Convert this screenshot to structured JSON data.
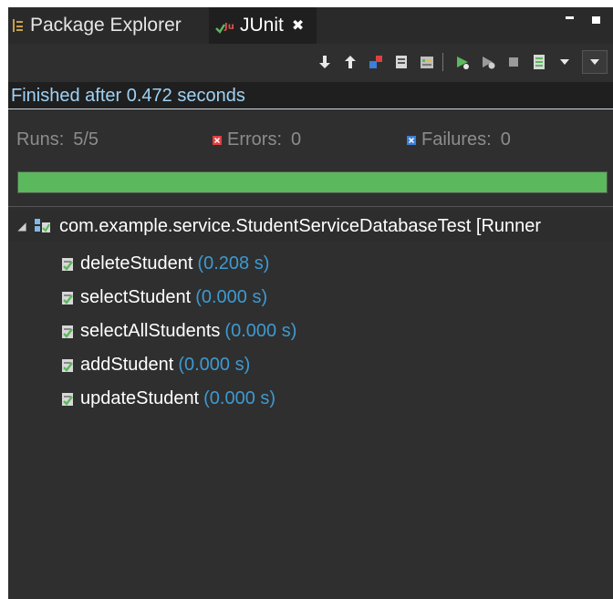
{
  "tabs": {
    "package_explorer": "Package Explorer",
    "junit": "JUnit",
    "junit_close": "✖"
  },
  "status": {
    "message": "Finished after 0.472 seconds"
  },
  "counters": {
    "runs_label": "Runs:",
    "runs_value": "5/5",
    "errors_label": "Errors:",
    "errors_value": "0",
    "failures_label": "Failures:",
    "failures_value": "0"
  },
  "progress": {
    "fraction": 1.0,
    "color": "#5cb85c"
  },
  "tree": {
    "root_label": "com.example.service.StudentServiceDatabaseTest [Runner",
    "tests": [
      {
        "name": "deleteStudent",
        "time": "(0.208 s)"
      },
      {
        "name": "selectStudent",
        "time": "(0.000 s)"
      },
      {
        "name": "selectAllStudents",
        "time": "(0.000 s)"
      },
      {
        "name": "addStudent",
        "time": "(0.000 s)"
      },
      {
        "name": "updateStudent",
        "time": "(0.000 s)"
      }
    ]
  },
  "colors": {
    "background": "#2f2f2f",
    "status_text": "#9fd2f5",
    "time_text": "#3d9ad1",
    "pass_green": "#5cb85c",
    "error_red": "#e04040",
    "failure_blue": "#3a7fd8"
  },
  "icons": {
    "package_explorer": "package-explorer-icon",
    "junit": "junit-icon",
    "toolbar": [
      "next-failure-icon",
      "previous-failure-icon",
      "show-failures-only-icon",
      "scroll-lock-icon",
      "show-skipped-icon",
      "rerun-test-icon",
      "rerun-failed-first-icon",
      "stop-icon",
      "test-run-history-icon",
      "history-dropdown-icon",
      "view-menu-icon"
    ],
    "test_suite": "test-suite-icon",
    "test_passed": "test-passed-icon"
  }
}
